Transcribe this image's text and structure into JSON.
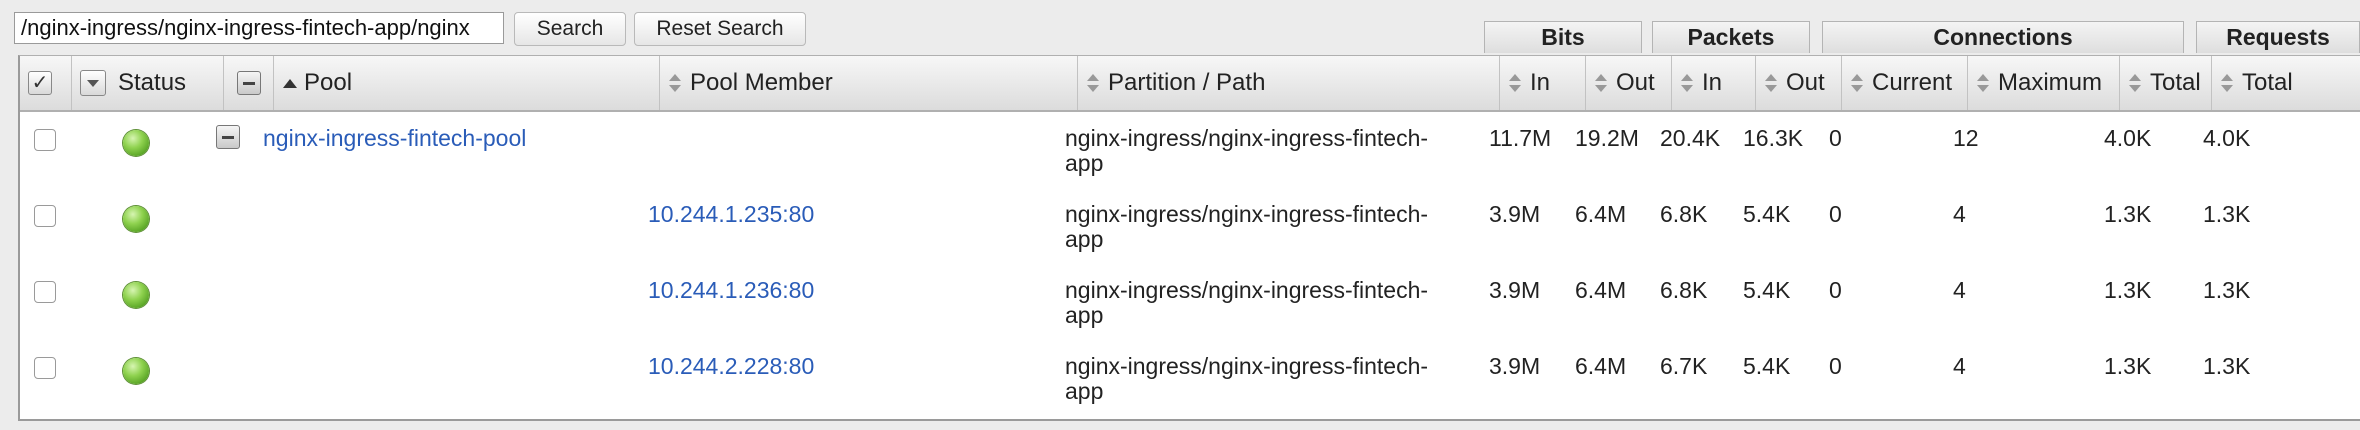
{
  "search": {
    "value": "/nginx-ingress/nginx-ingress-fintech-app/nginx",
    "search_label": "Search",
    "reset_label": "Reset Search"
  },
  "group_headers": [
    "Bits",
    "Packets",
    "Connections",
    "Requests"
  ],
  "columns": {
    "status": "Status",
    "pool": "Pool",
    "pool_member": "Pool Member",
    "partition_path": "Partition / Path",
    "bits_in": "In",
    "bits_out": "Out",
    "packets_in": "In",
    "packets_out": "Out",
    "conn_current": "Current",
    "conn_maximum": "Maximum",
    "conn_total": "Total",
    "req_total": "Total"
  },
  "rows": [
    {
      "status": "available",
      "pool": "nginx-ingress-fintech-pool",
      "member": "",
      "path_line1": "nginx-ingress/nginx-ingress-fintech-",
      "path_line2": "app",
      "bits_in": "11.7M",
      "bits_out": "19.2M",
      "packets_in": "20.4K",
      "packets_out": "16.3K",
      "current": "0",
      "maximum": "12",
      "conn_total": "4.0K",
      "req_total": "4.0K"
    },
    {
      "status": "available",
      "pool": "",
      "member": "10.244.1.235:80",
      "path_line1": "nginx-ingress/nginx-ingress-fintech-",
      "path_line2": "app",
      "bits_in": "3.9M",
      "bits_out": "6.4M",
      "packets_in": "6.8K",
      "packets_out": "5.4K",
      "current": "0",
      "maximum": "4",
      "conn_total": "1.3K",
      "req_total": "1.3K"
    },
    {
      "status": "available",
      "pool": "",
      "member": "10.244.1.236:80",
      "path_line1": "nginx-ingress/nginx-ingress-fintech-",
      "path_line2": "app",
      "bits_in": "3.9M",
      "bits_out": "6.4M",
      "packets_in": "6.8K",
      "packets_out": "5.4K",
      "current": "0",
      "maximum": "4",
      "conn_total": "1.3K",
      "req_total": "1.3K"
    },
    {
      "status": "available",
      "pool": "",
      "member": "10.244.2.228:80",
      "path_line1": "nginx-ingress/nginx-ingress-fintech-",
      "path_line2": "app",
      "bits_in": "3.9M",
      "bits_out": "6.4M",
      "packets_in": "6.7K",
      "packets_out": "5.4K",
      "current": "0",
      "maximum": "4",
      "conn_total": "1.3K",
      "req_total": "1.3K"
    }
  ],
  "colors": {
    "link": "#2a5cb8",
    "status_available": "#6cbf2a"
  }
}
